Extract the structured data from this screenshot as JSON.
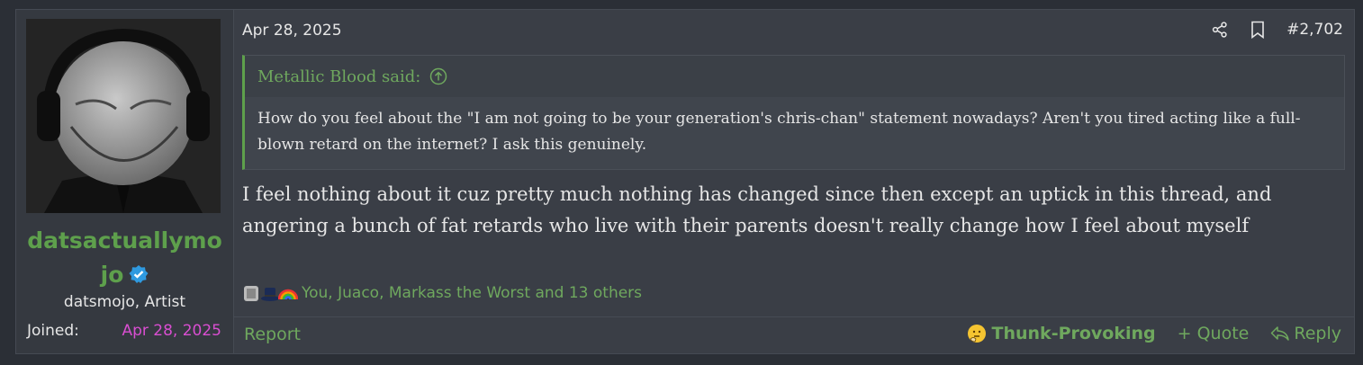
{
  "post": {
    "date": "Apr 28, 2025",
    "number": "#2,702",
    "icons": {
      "share": "share-icon",
      "bookmark": "bookmark-icon"
    }
  },
  "user": {
    "name": "datsactuallymo jo",
    "title": "datsmojo, Artist",
    "joined_label": "Joined:",
    "joined_value": "Apr 28, 2025"
  },
  "quote": {
    "author": "Metallic Blood said:",
    "text": "How do you feel about the \"I am not going to be your generation's chris-chan\" statement nowadays? Aren't you tired acting like a full-blown retard on the internet? I ask this genuinely."
  },
  "message": "I feel nothing about it cuz pretty much nothing has changed since then except an uptick in this thread, and angering a bunch of fat retards who live with their parents doesn't really change how I feel about myself",
  "reactions": {
    "text": "You, Juaco, Markass the Worst and 13 others"
  },
  "footer": {
    "report": "Report",
    "reaction": "Thunk-Provoking",
    "quote": "+ Quote",
    "reply": "Reply"
  },
  "colors": {
    "accent_green": "#5ea04c",
    "joined_pink": "#d94ed1",
    "background": "#2b2f36"
  }
}
